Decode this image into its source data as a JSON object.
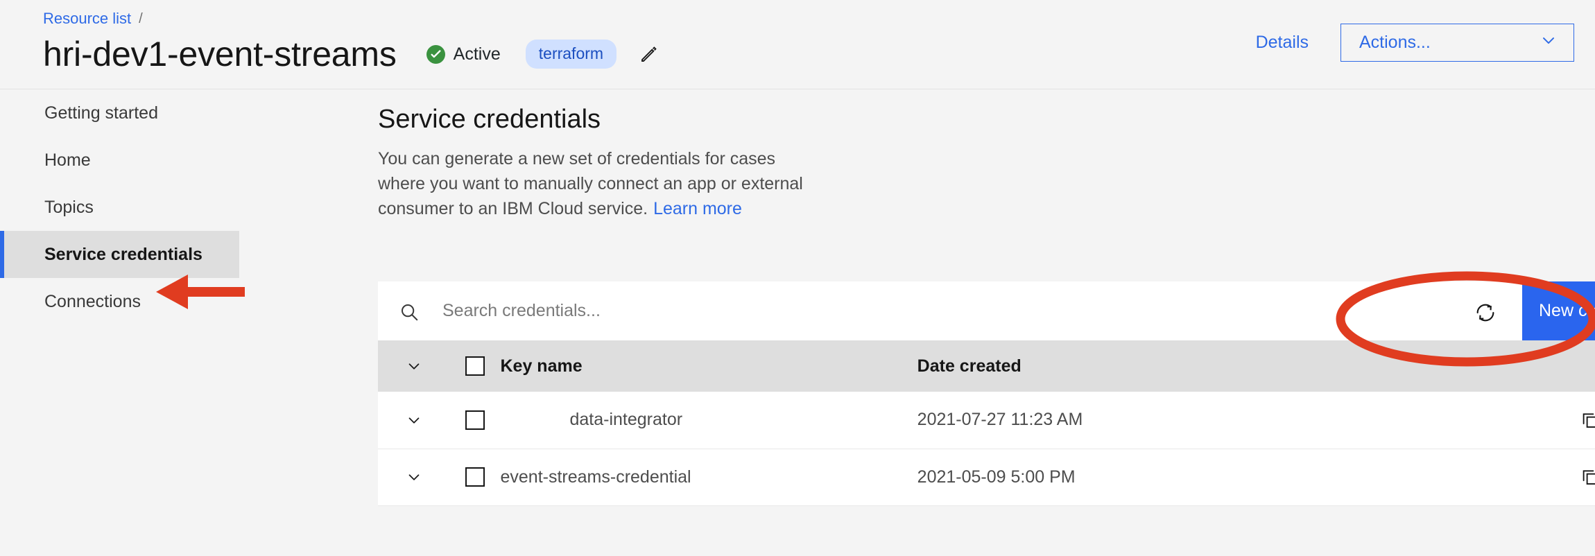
{
  "breadcrumb": {
    "link": "Resource list",
    "separator": "/"
  },
  "header": {
    "title": "hri-dev1-event-streams",
    "status": "Active",
    "tag": "terraform",
    "edit_icon": "pencil-icon",
    "details_label": "Details",
    "actions_label": "Actions...",
    "chevron_icon": "chevron-down-icon"
  },
  "sidebar": {
    "items": [
      {
        "label": "Getting started",
        "active": false
      },
      {
        "label": "Home",
        "active": false
      },
      {
        "label": "Topics",
        "active": false
      },
      {
        "label": "Service credentials",
        "active": true
      },
      {
        "label": "Connections",
        "active": false
      }
    ]
  },
  "main": {
    "title": "Service credentials",
    "description": "You can generate a new set of credentials for cases where you want to manually connect an app or external consumer to an IBM Cloud service.",
    "learn_more": "Learn more"
  },
  "toolbar": {
    "search_placeholder": "Search credentials...",
    "search_value": "",
    "search_icon": "search-icon",
    "refresh_icon": "refresh-icon",
    "new_credential_label": "New credential",
    "new_credential_plus": "+"
  },
  "table": {
    "columns": [
      "Key name",
      "Date created"
    ],
    "rows": [
      {
        "key_name": "data-integrator",
        "date_created": "2021-07-27 11:23 AM",
        "copy_icon": "copy-icon",
        "delete_icon": "trash-icon"
      },
      {
        "key_name": "event-streams-credential",
        "date_created": "2021-05-09 5:00 PM",
        "copy_icon": "copy-icon",
        "delete_icon": "trash-icon"
      }
    ]
  },
  "annotations": {
    "arrow": "red-arrow-pointing-to-service-credentials",
    "oval": "red-oval-around-new-credential-button"
  },
  "colors": {
    "accent_blue": "#2a65ee",
    "link_blue": "#2e6ae6",
    "status_green": "#3a923f",
    "tag_bg": "#d0e0ff",
    "tag_text": "#1c4fc0",
    "page_bg": "#f4f4f4",
    "active_nav_bg": "#dedede",
    "annotation_red": "#e03c20"
  }
}
